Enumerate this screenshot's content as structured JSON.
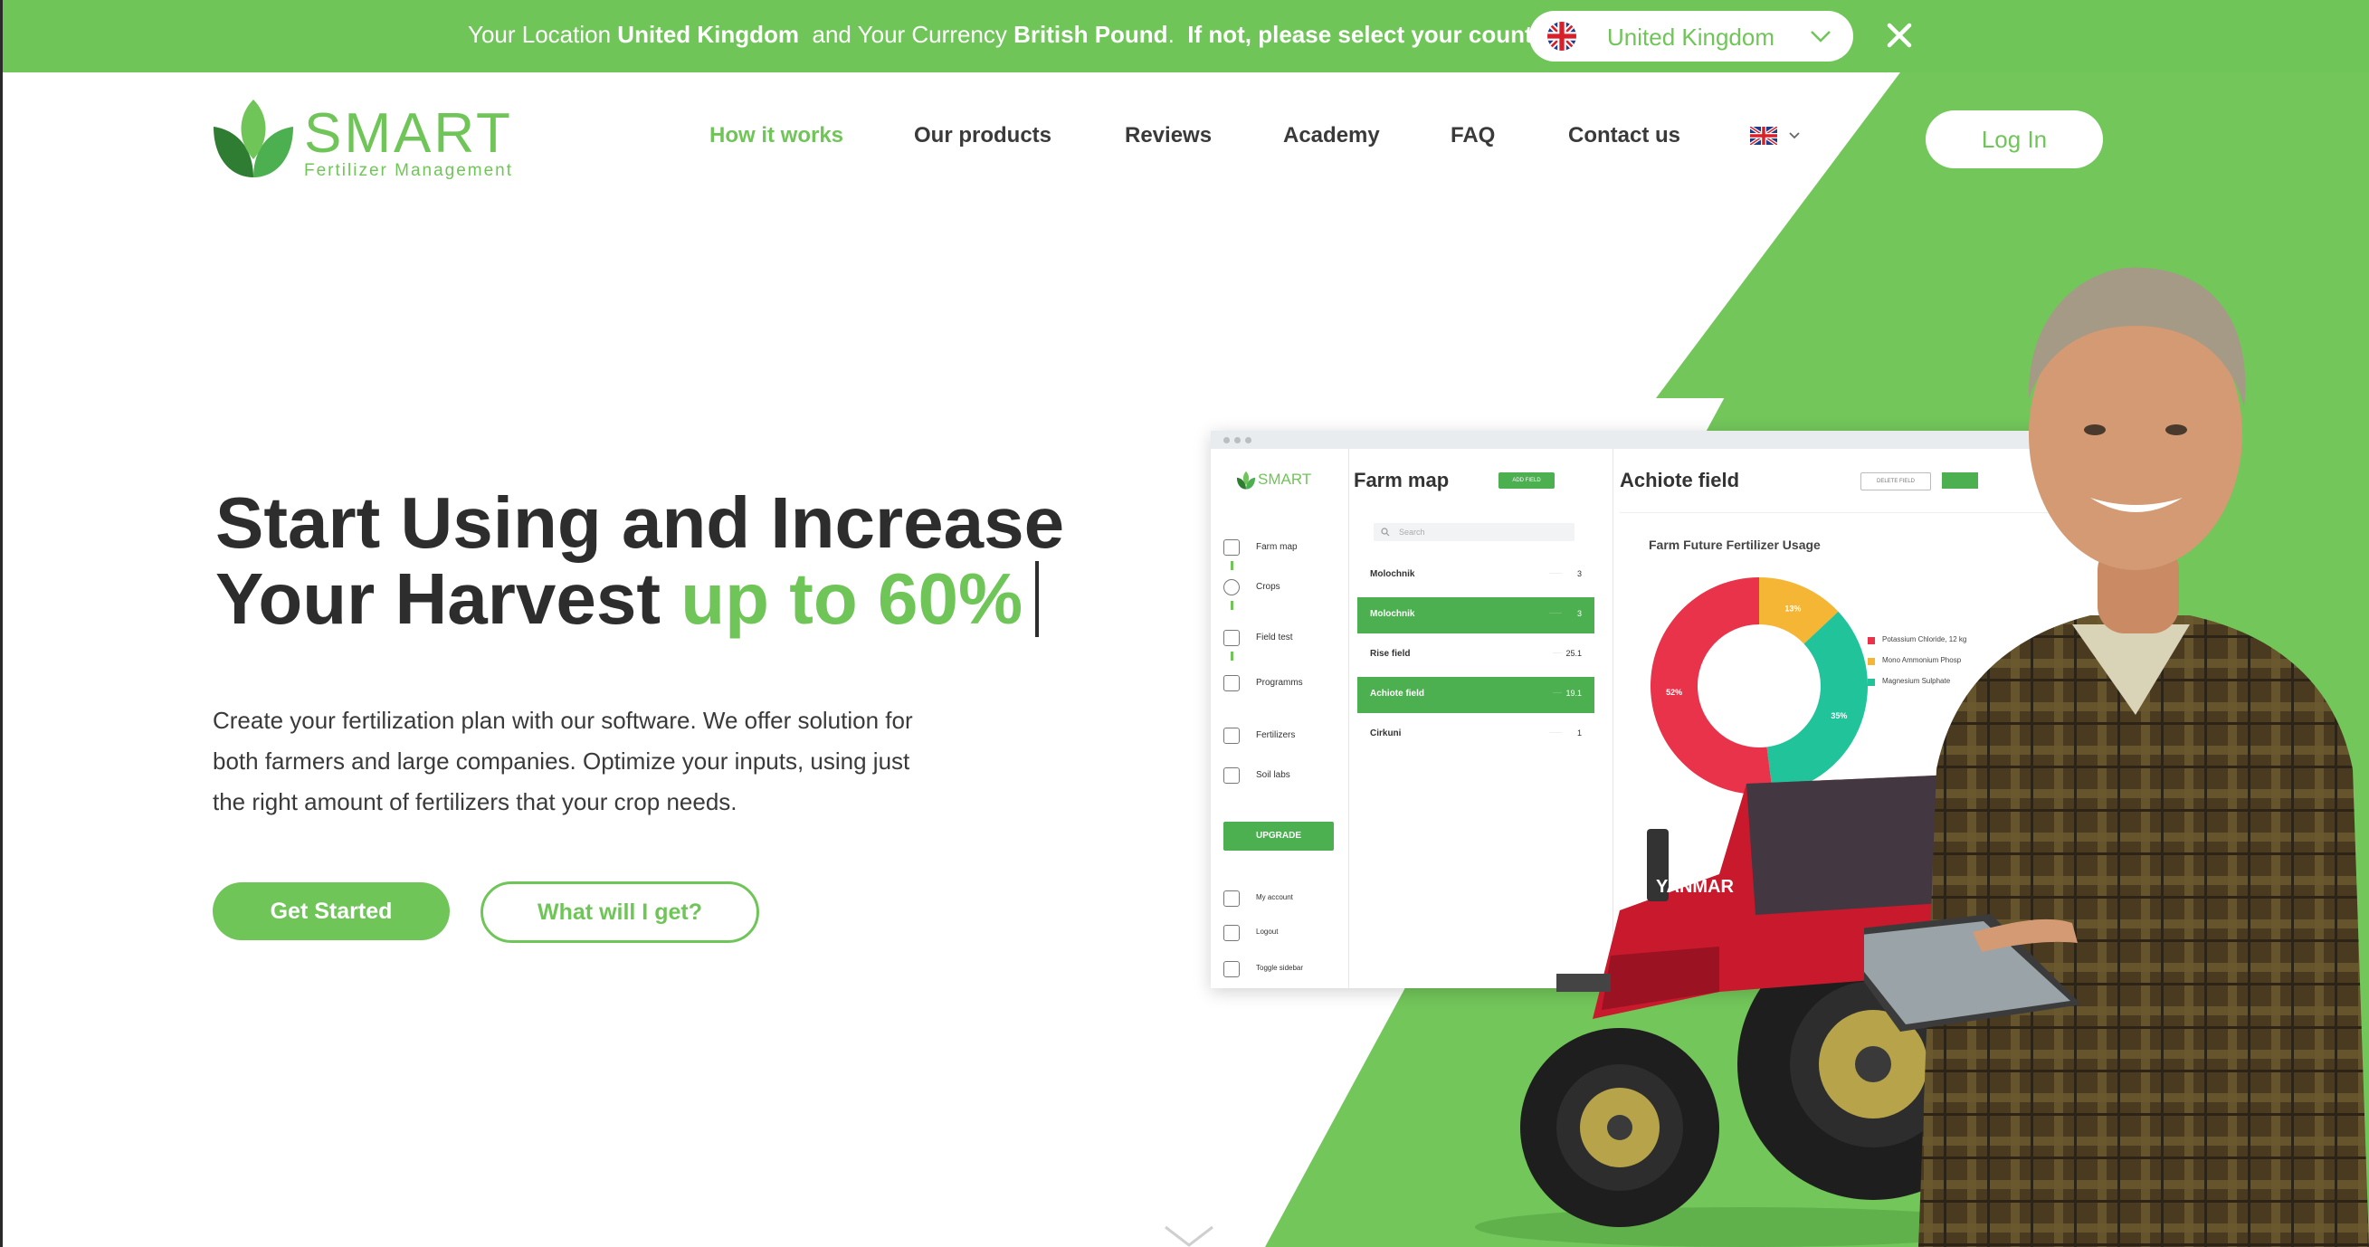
{
  "location_bar": {
    "text_prefix": "Your Location",
    "location": "United Kingdom",
    "text_mid": "and Your Currency",
    "currency": "British Pound",
    "prompt": "If not, please select your country.",
    "selected_country": "United Kingdom"
  },
  "logo": {
    "word": "SMART",
    "sub": "Fertilizer Management"
  },
  "nav": {
    "items": [
      {
        "label": "How it works"
      },
      {
        "label": "Our products"
      },
      {
        "label": "Reviews"
      },
      {
        "label": "Academy"
      },
      {
        "label": "FAQ"
      },
      {
        "label": "Contact us"
      }
    ],
    "active": "How it works",
    "login": "Log In"
  },
  "hero": {
    "title_line1": "Start Using and Increase",
    "title_line2": "Your Harvest",
    "title_accent": "up to 60%",
    "description": "Create your fertilization plan with our software. We offer solution for both farmers and large companies. Optimize your inputs, using just the right amount of fertilizers that your crop needs.",
    "primary_cta": "Get Started",
    "secondary_cta": "What will I get?"
  },
  "mockup": {
    "logo": "SMART",
    "sidebar": {
      "items": [
        "Farm map",
        "Crops",
        "Field test",
        "Programms",
        "Fertilizers",
        "Soil labs"
      ],
      "upgrade": "UPGRADE",
      "bottom": [
        "My account",
        "Logout",
        "Toggle sidebar"
      ]
    },
    "farm_map": {
      "title": "Farm map",
      "add_button": "ADD FIELD",
      "search_placeholder": "Search",
      "fields": [
        {
          "name": "Molochnik",
          "value": "3",
          "selected": false
        },
        {
          "name": "Molochnik",
          "value": "3",
          "selected": true
        },
        {
          "name": "Rise field",
          "value": "25.1",
          "selected": false
        },
        {
          "name": "Achiote field",
          "value": "19.1",
          "selected": true
        },
        {
          "name": "Cirkuni",
          "value": "1",
          "selected": false
        }
      ]
    },
    "field_view": {
      "title": "Achiote field",
      "delete_button": "DELETE FIELD",
      "chart_title": "Farm Future Fertilizer Usage"
    }
  },
  "chart_data": {
    "type": "pie",
    "title": "Farm Future Fertilizer Usage",
    "donut": true,
    "categories": [
      "Potassium Chloride, 12 kg",
      "Mono Ammonium Phosp",
      "Magnesium Sulphate"
    ],
    "values": [
      52,
      13,
      35
    ],
    "labels": [
      "52%",
      "13%",
      "35%"
    ],
    "colors": [
      "#e8334a",
      "#f5b535",
      "#20c39a"
    ],
    "legend": "right"
  },
  "colors": {
    "brand_green": "#70c559",
    "app_green": "#4caf50",
    "text_dark": "#2d2d2d"
  }
}
